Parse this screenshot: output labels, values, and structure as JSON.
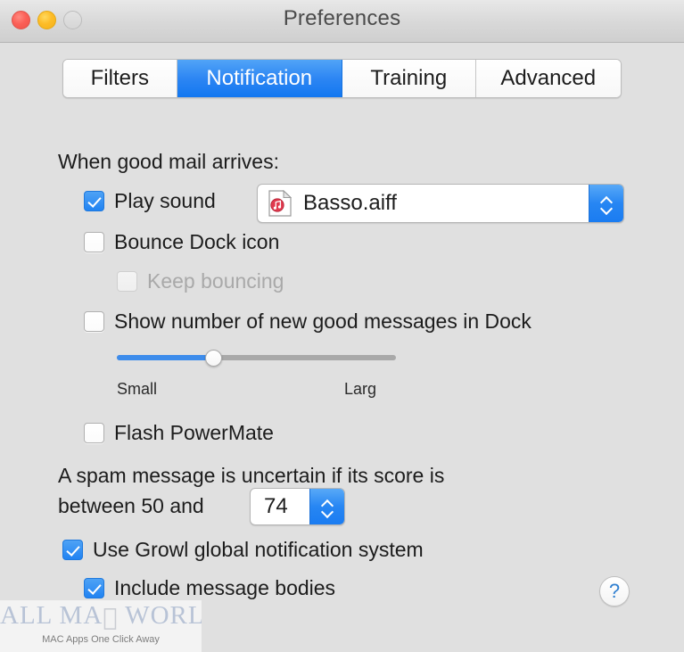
{
  "window": {
    "title": "Preferences",
    "traffic_lights": [
      {
        "name": "close",
        "color": "#fb6058"
      },
      {
        "name": "minimize",
        "color": "#fdbc27"
      },
      {
        "name": "zoom",
        "color": "#dcdcdc"
      }
    ],
    "background_color": "#e0e0e0"
  },
  "tabs": [
    {
      "label": "Filters",
      "selected": false
    },
    {
      "label": "Notification",
      "selected": true
    },
    {
      "label": "Training",
      "selected": false
    },
    {
      "label": "Advanced",
      "selected": false
    }
  ],
  "accent_color": "#2183f2",
  "main": {
    "section_heading": "When good mail arrives:",
    "play_sound": {
      "label": "Play sound",
      "checked": true,
      "sound_value": "Basso.aiff",
      "sound_icon": "audio-file-icon"
    },
    "bounce_dock": {
      "label": "Bounce Dock icon",
      "checked": false
    },
    "keep_bouncing": {
      "label": "Keep bouncing",
      "checked": false,
      "disabled": true
    },
    "show_number": {
      "label": "Show number of new good messages in Dock",
      "checked": false
    },
    "size_slider": {
      "min_label": "Small",
      "max_label": "Larg",
      "value_fraction": 0.345
    },
    "flash_powermate": {
      "label": "Flash PowerMate",
      "checked": false
    },
    "uncertain_sentence": {
      "line1": "A spam message is uncertain if its score is",
      "line2": "between 50 and",
      "score_value": "74"
    },
    "use_growl": {
      "label": "Use Growl global notification system",
      "checked": true
    },
    "include_bodies": {
      "label": "Include message bodies",
      "checked": true
    },
    "help_label": "?"
  },
  "watermark": {
    "text_before": "ALL MA",
    "apple_glyph": "",
    "text_after": "WORLD",
    "tagline": "MAC Apps One Click Away"
  }
}
